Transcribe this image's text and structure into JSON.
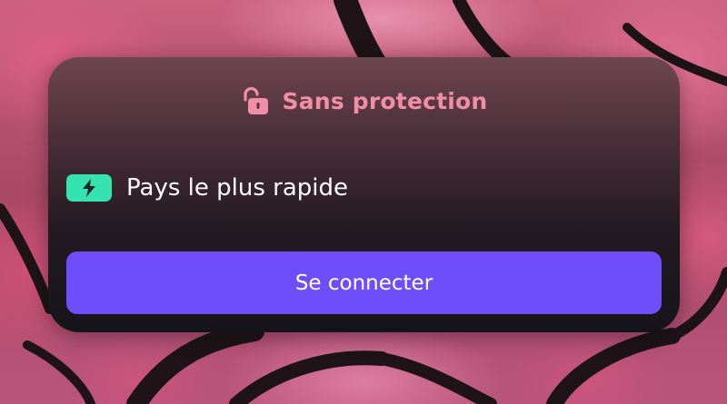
{
  "status": {
    "label": "Sans protection",
    "icon": "unlocked-padlock-icon",
    "color": "#f28fa6"
  },
  "country": {
    "label": "Pays le plus rapide",
    "icon": "lightning-bolt-icon",
    "badge_color": "#35e3b0"
  },
  "connect_button": {
    "label": "Se connecter",
    "color": "#6e4ef9"
  }
}
